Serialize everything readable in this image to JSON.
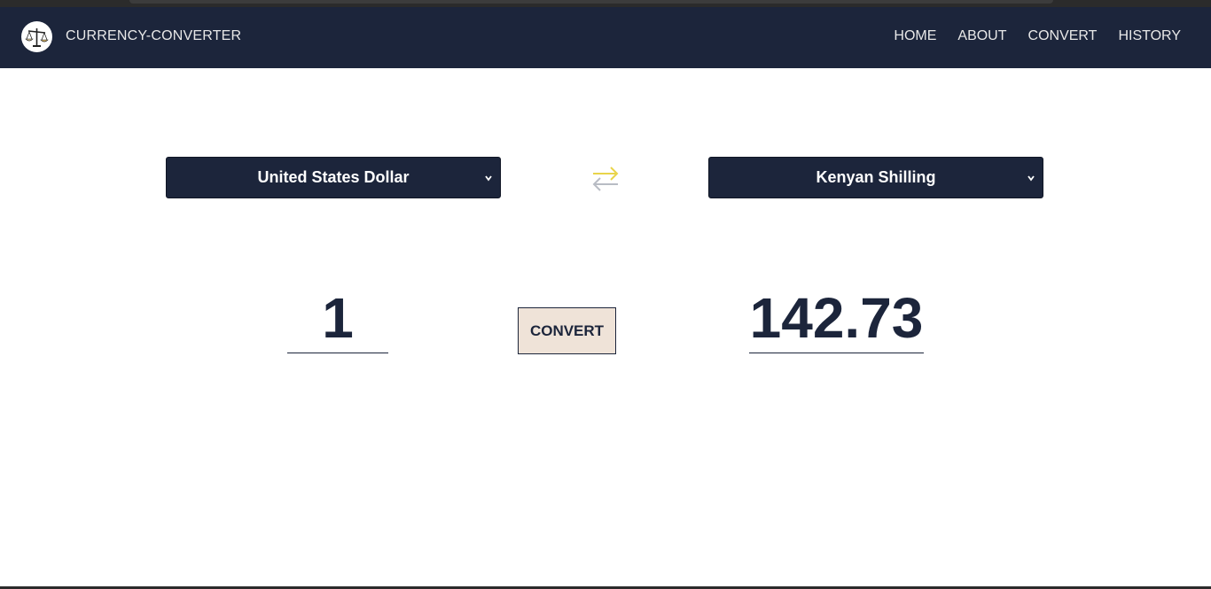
{
  "navbar": {
    "brand": "CURRENCY-CONVERTER",
    "links": [
      "HOME",
      "ABOUT",
      "CONVERT",
      "HISTORY"
    ]
  },
  "converter": {
    "from_currency": "United States Dollar",
    "to_currency": "Kenyan Shilling",
    "amount": "1",
    "result": "142.73",
    "convert_label": "CONVERT"
  },
  "colors": {
    "navbar_bg": "#1c253b",
    "button_bg": "#efe3d8",
    "swap_arrow_top": "#e9d44a",
    "swap_arrow_bottom": "#b8bcc4"
  },
  "icons": {
    "logo": "scales-icon",
    "swap": "swap-arrows-icon",
    "dropdown": "chevron-down-icon"
  }
}
